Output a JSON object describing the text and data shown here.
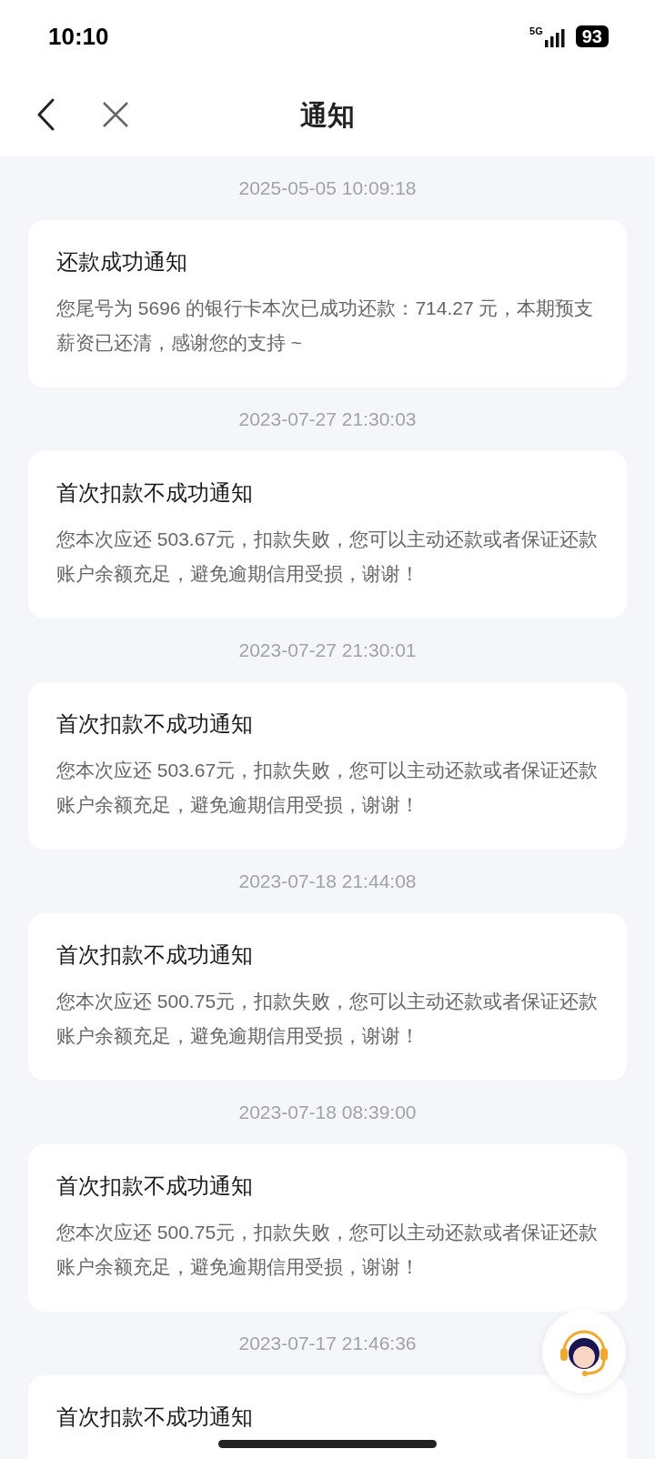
{
  "status_bar": {
    "time": "10:10",
    "network": "5G",
    "battery": "93"
  },
  "nav": {
    "title": "通知"
  },
  "notifications": [
    {
      "time": "2025-05-05 10:09:18",
      "title": "还款成功通知",
      "body": "您尾号为 5696 的银行卡本次已成功还款：714.27 元，本期预支薪资已还清，感谢您的支持 ~"
    },
    {
      "time": "2023-07-27 21:30:03",
      "title": "首次扣款不成功通知",
      "body": "您本次应还 503.67元，扣款失败，您可以主动还款或者保证还款账户余额充足，避免逾期信用受损，谢谢！"
    },
    {
      "time": "2023-07-27 21:30:01",
      "title": "首次扣款不成功通知",
      "body": "您本次应还 503.67元，扣款失败，您可以主动还款或者保证还款账户余额充足，避免逾期信用受损，谢谢！"
    },
    {
      "time": "2023-07-18 21:44:08",
      "title": "首次扣款不成功通知",
      "body": "您本次应还 500.75元，扣款失败，您可以主动还款或者保证还款账户余额充足，避免逾期信用受损，谢谢！"
    },
    {
      "time": "2023-07-18 08:39:00",
      "title": "首次扣款不成功通知",
      "body": "您本次应还 500.75元，扣款失败，您可以主动还款或者保证还款账户余额充足，避免逾期信用受损，谢谢！"
    },
    {
      "time": "2023-07-17 21:46:36",
      "title": "首次扣款不成功通知"
    }
  ]
}
